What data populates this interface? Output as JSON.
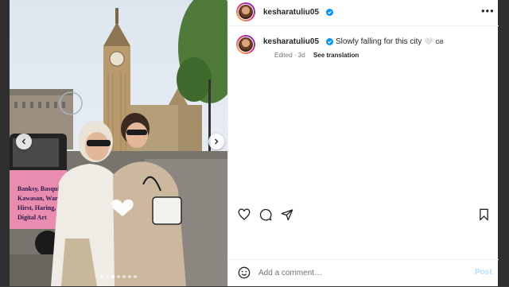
{
  "post": {
    "username": "kesharatuliu05",
    "caption": "Slowly falling for this city",
    "caption_emoji": "🤍",
    "caption_tag": "GB",
    "edited": "Edited",
    "age": "3d",
    "see_translation": "See translation"
  },
  "carousel": {
    "slide_count": 7,
    "active_index": 2,
    "sign_lines": [
      "Banksy, Basquiat,",
      "Kawasan, Warhol,",
      "Hirst, Haring,",
      "Digital Art"
    ]
  },
  "icons": {
    "like": "heart-icon",
    "comment": "comment-bubble-icon",
    "share": "paper-plane-icon",
    "save": "bookmark-icon",
    "emoji": "smiley-icon",
    "more": "more-dots-icon",
    "verified": "verified-badge-icon"
  },
  "comment": {
    "placeholder": "Add a comment…",
    "post_label": "Post"
  },
  "colors": {
    "verified": "#0095f6",
    "post_disabled": "#b2dffc",
    "text": "#262626",
    "muted": "#737373"
  }
}
